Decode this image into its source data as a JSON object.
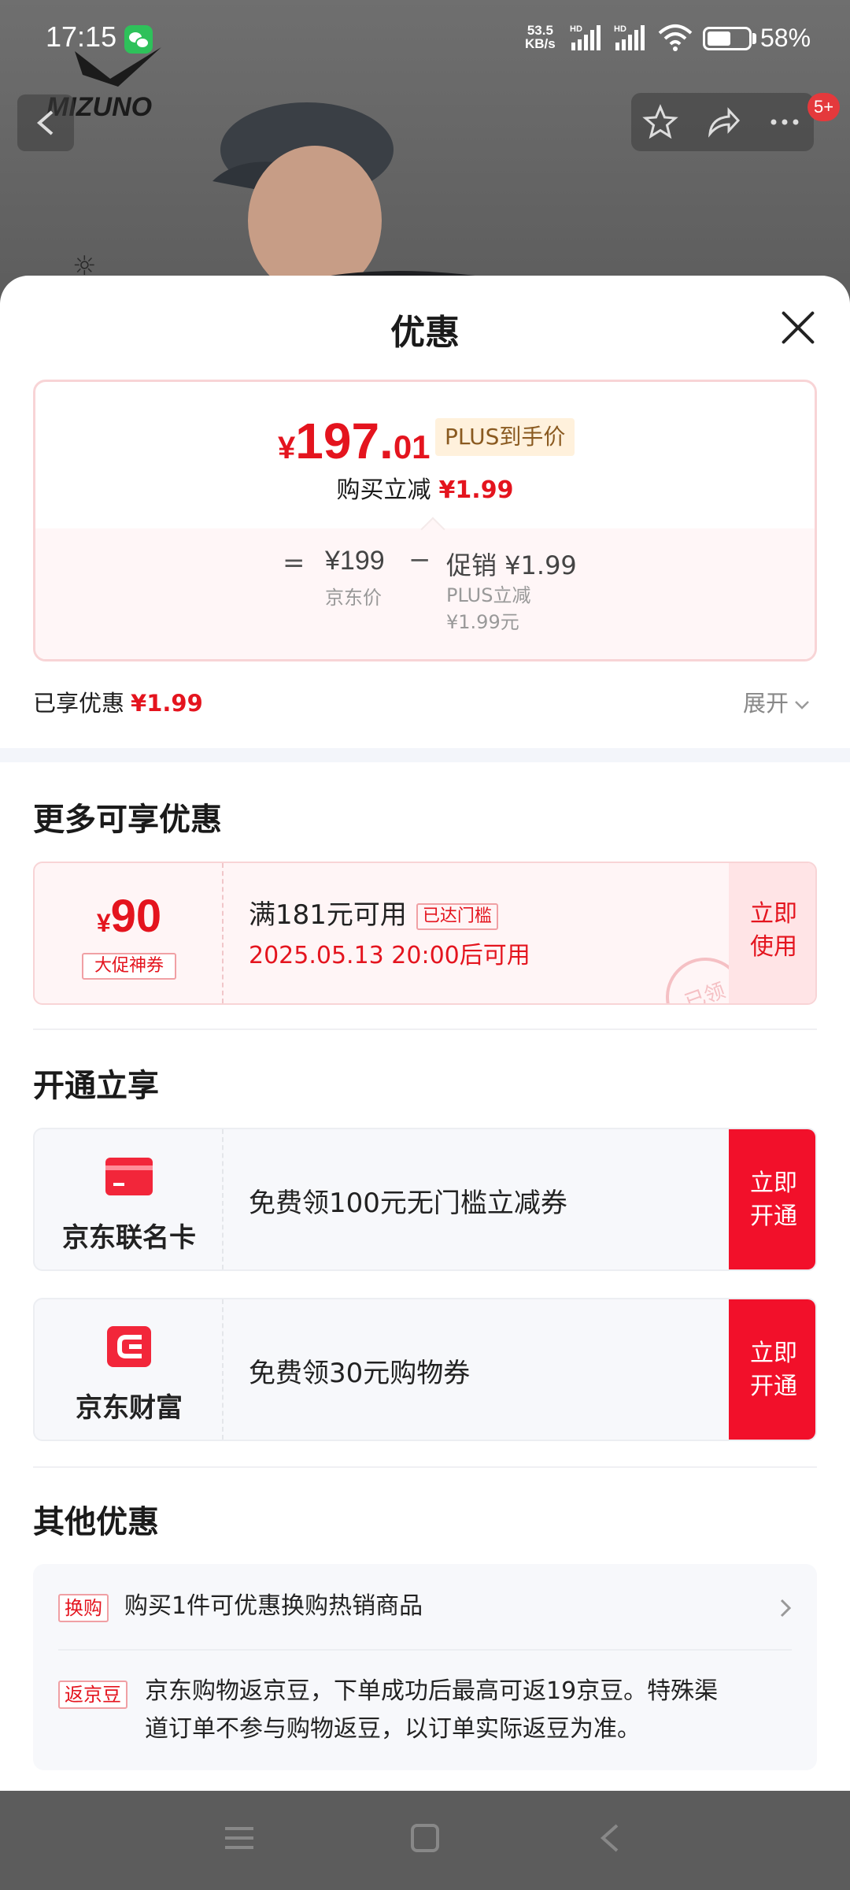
{
  "status_bar": {
    "time": "17:15",
    "net_speed_value": "53.5",
    "net_speed_unit": "KB/s",
    "sim1_label": "HD",
    "sim2_label": "HD",
    "battery_percent": "58%",
    "battery_level": 0.58
  },
  "background": {
    "brand_logo": "MIZUNO",
    "cart_badge": "5+"
  },
  "sheet": {
    "title": "优惠",
    "price_card": {
      "yen": "¥",
      "price_int": "197.",
      "price_dec": "01",
      "plus_tag": "PLUS到手价",
      "buy_reduce_label": "购买立减",
      "buy_reduce_value": "¥1.99",
      "equals": "=",
      "jd_price": "¥199",
      "jd_price_label": "京东价",
      "minus": "−",
      "promo_label": "促销 ¥1.99",
      "promo_sub1": "PLUS立减",
      "promo_sub2": "¥1.99元"
    },
    "enjoyed_label": "已享优惠",
    "enjoyed_value": "¥1.99",
    "expand_label": "展开"
  },
  "more_section": {
    "title": "更多可享优惠",
    "coupon": {
      "yen": "¥",
      "amount": "90",
      "tag": "大促神券",
      "condition": "满181元可用",
      "threshold_tag": "已达门槛",
      "time": "2025.05.13 20:00后可用",
      "button": "立即使用",
      "stamp": "已领"
    }
  },
  "open_section": {
    "title": "开通立享",
    "services": [
      {
        "name": "京东联名卡",
        "desc": "免费领100元无门槛立减券",
        "button": "立即开通",
        "icon": "credit-card-icon"
      },
      {
        "name": "京东财富",
        "desc": "免费领30元购物券",
        "button": "立即开通",
        "icon": "jd-finance-icon"
      }
    ]
  },
  "other_section": {
    "title": "其他优惠",
    "items": [
      {
        "tag": "换购",
        "text": "购买1件可优惠换购热销商品"
      },
      {
        "tag": "返京豆",
        "text_line1": "京东购物返京豆，下单成功后最高可返19京豆。特殊渠",
        "text_line2": "道订单不参与购物返豆，以订单实际返豆为准。"
      }
    ]
  },
  "colors": {
    "accent_red": "#e4141e",
    "button_red": "#f2102a",
    "plus_gold": "#8a5a20"
  }
}
